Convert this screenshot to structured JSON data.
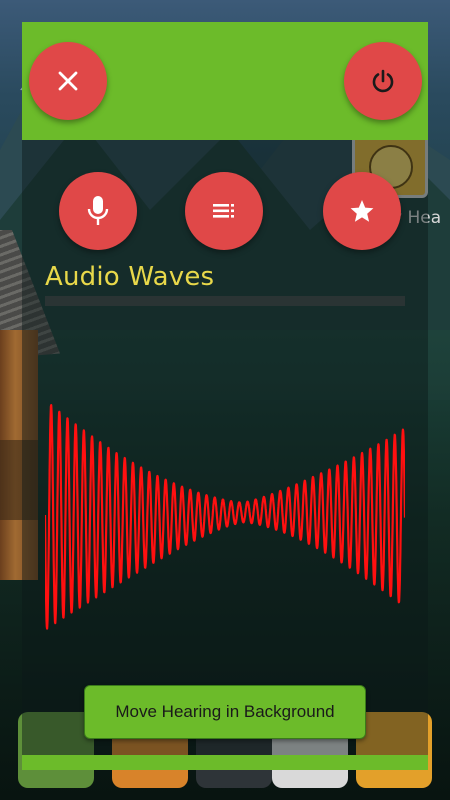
{
  "colors": {
    "accent_green": "#6cbb2a",
    "button_red": "#e04848",
    "title_yellow": "#e8d84a",
    "wave_red": "#ff1010"
  },
  "top_bar": {
    "close_icon": "close-icon",
    "power_icon": "power-icon"
  },
  "actions": {
    "mic_icon": "microphone-icon",
    "list_icon": "playlist-icon",
    "star_icon": "star-icon"
  },
  "panel": {
    "title": "Audio Waves",
    "level_fraction": 0
  },
  "toast": {
    "label": "Move Hearing in Background"
  },
  "background": {
    "app_label": "y Hea"
  }
}
